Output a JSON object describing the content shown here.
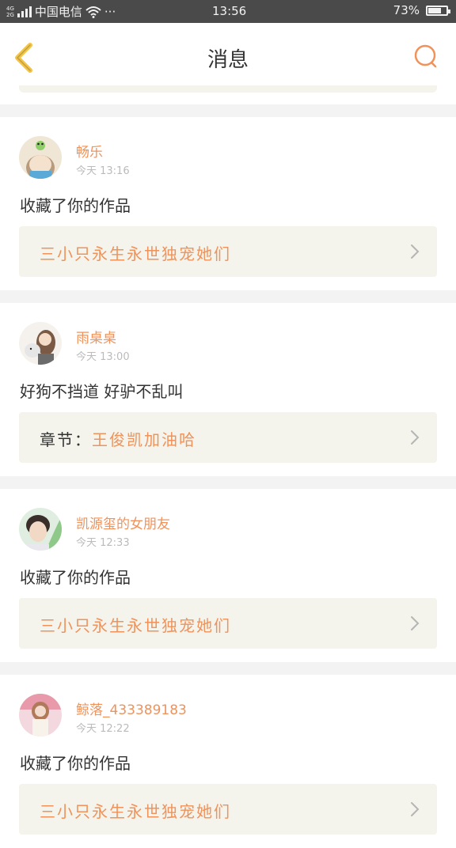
{
  "status_bar": {
    "network_top": "4G",
    "network_bottom": "2G",
    "carrier": "中国电信",
    "more": "···",
    "time": "13:56",
    "battery_percent": "73%",
    "battery_level": 0.73
  },
  "header": {
    "title": "消息"
  },
  "messages": [
    {
      "username": "畅乐",
      "time": "今天 13:16",
      "text": "收藏了你的作品",
      "quote_prefix": "",
      "quote": "三小只永生永世独宠她们"
    },
    {
      "username": "雨桌桌",
      "time": "今天 13:00",
      "text": "好狗不挡道 好驴不乱叫",
      "quote_prefix": "章节：",
      "quote": "王俊凯加油哈"
    },
    {
      "username": "凯源玺的女朋友",
      "time": "今天 12:33",
      "text": "收藏了你的作品",
      "quote_prefix": "",
      "quote": "三小只永生永世独宠她们"
    },
    {
      "username": "鲸落_433389183",
      "time": "今天 12:22",
      "text": "收藏了你的作品",
      "quote_prefix": "",
      "quote": "三小只永生永世独宠她们"
    }
  ],
  "colors": {
    "accent": "#f0925a",
    "back_icon": "#f5c542",
    "status_bar_bg": "#4a4a4a",
    "quote_bg": "#f4f4ec"
  },
  "icons": {
    "back": "chevron-left-icon",
    "search": "search-icon",
    "quote_arrow": "chevron-right-icon",
    "wifi": "wifi-icon",
    "signal": "signal-icon",
    "battery": "battery-icon"
  }
}
